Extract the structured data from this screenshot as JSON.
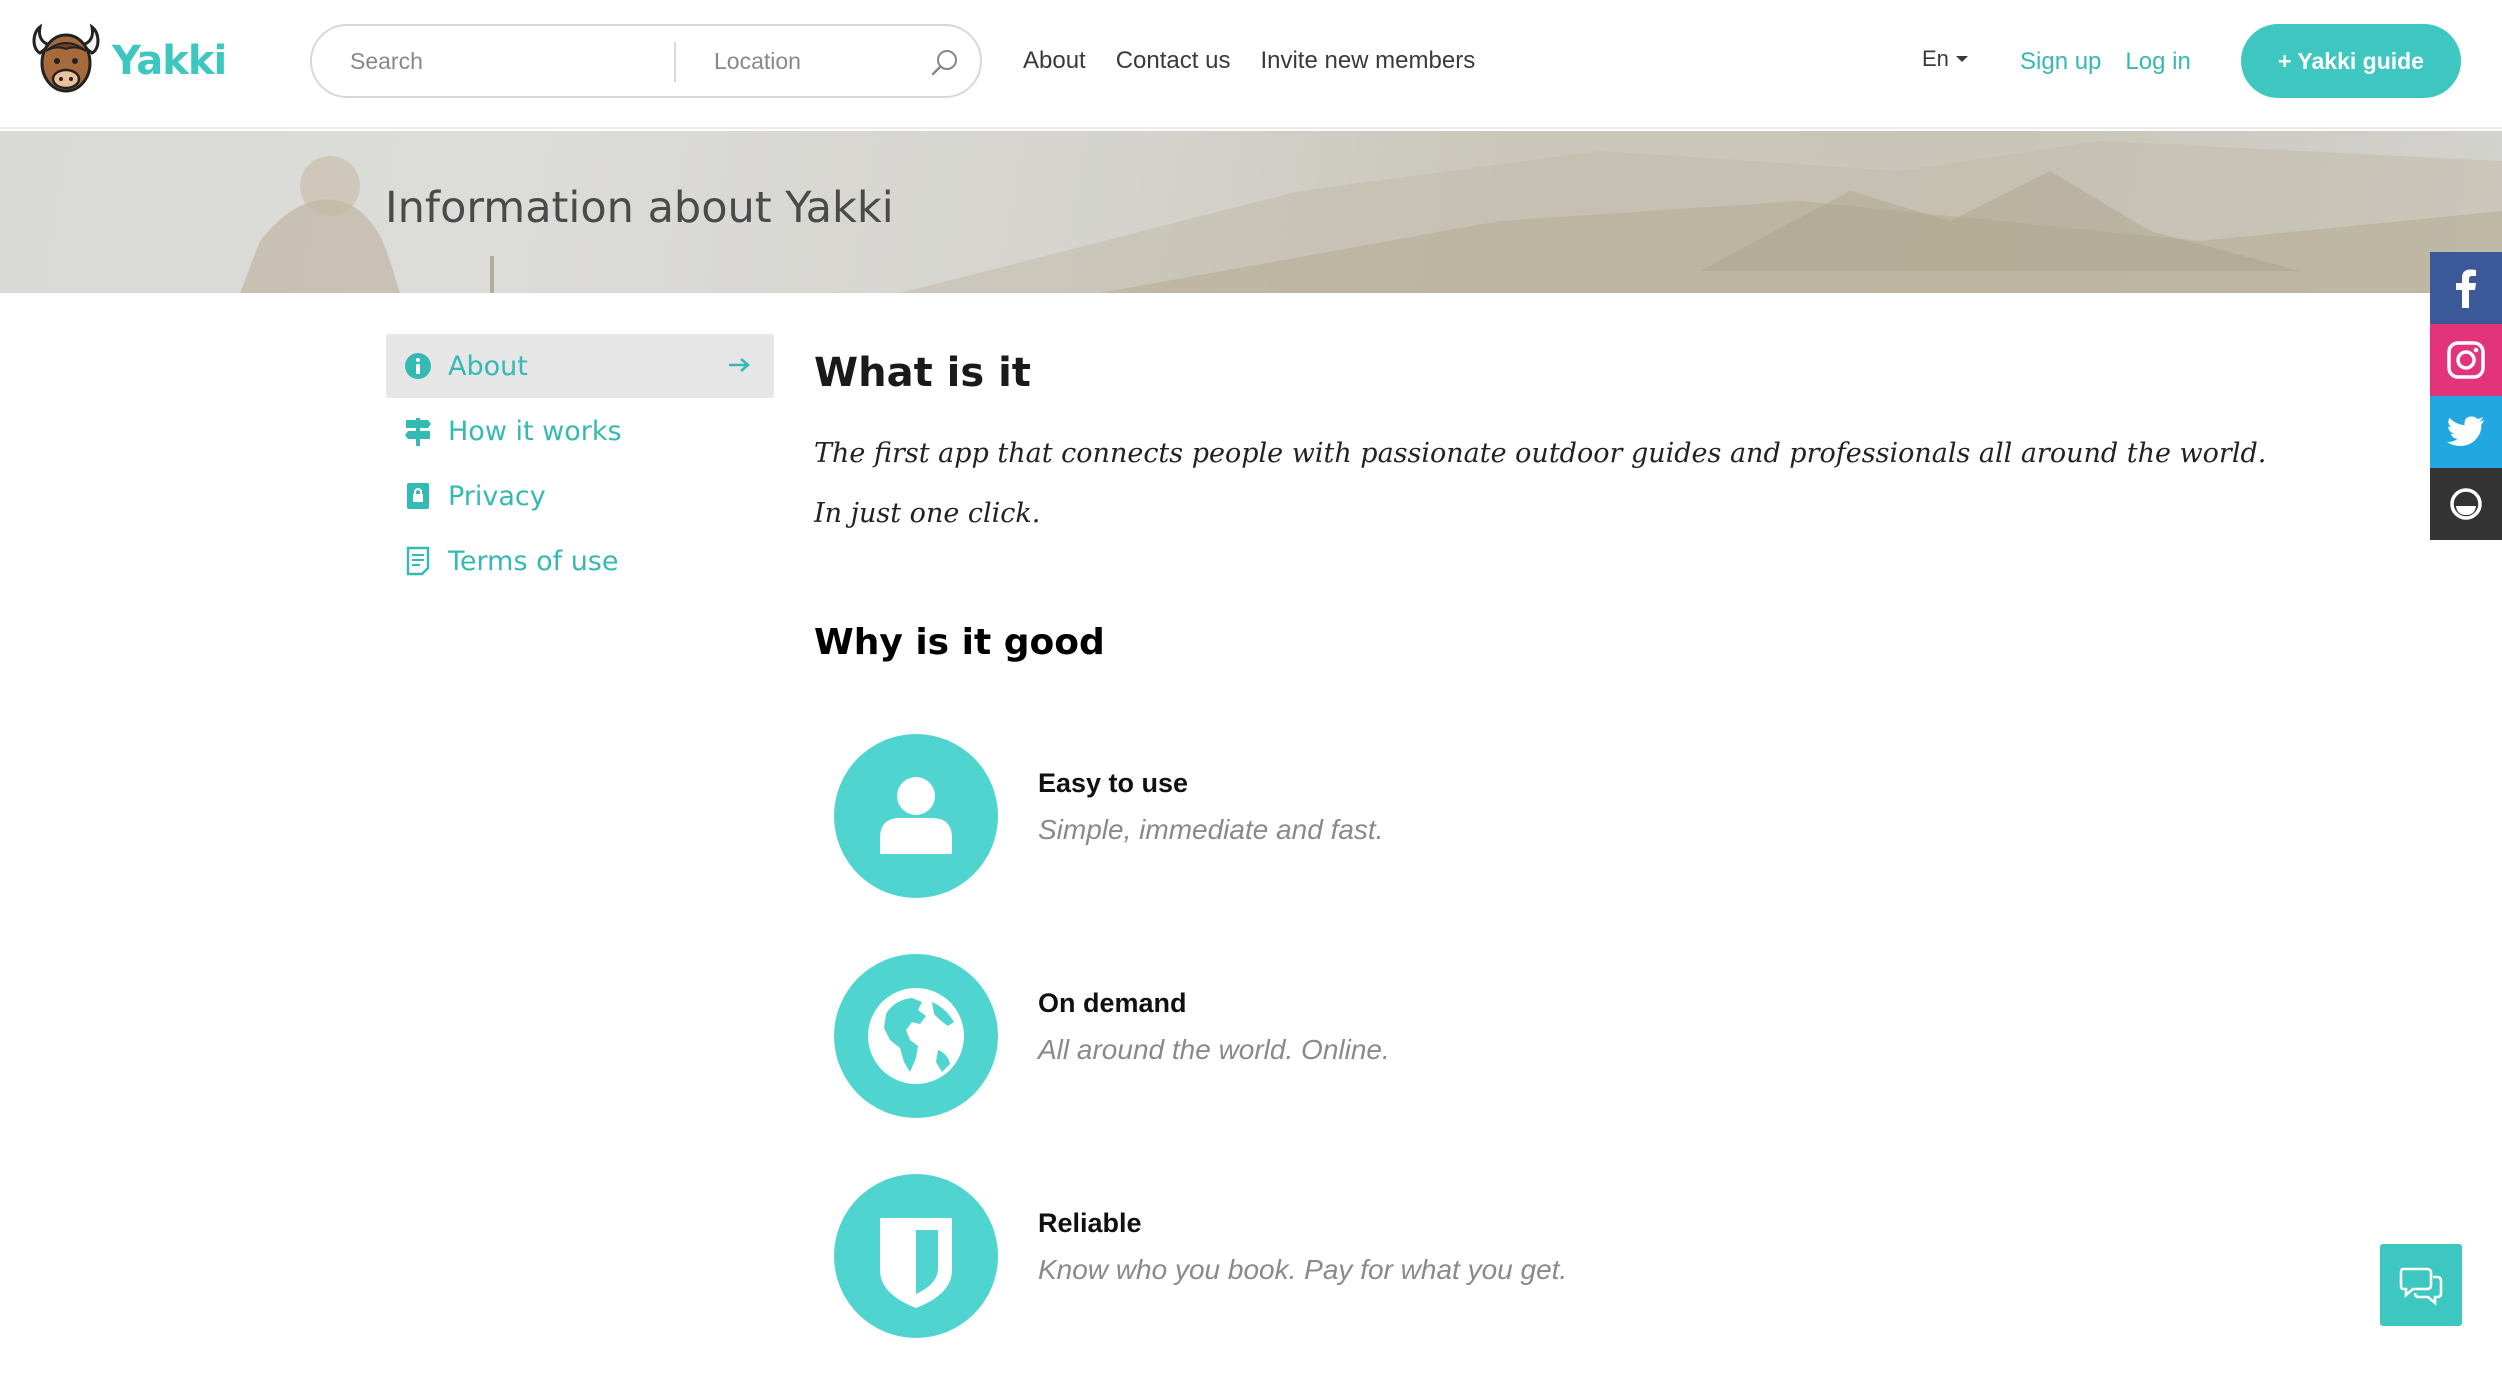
{
  "header": {
    "brand": "Yakki",
    "search_placeholder": "Search",
    "location_placeholder": "Location",
    "nav": [
      "About",
      "Contact us",
      "Invite new members"
    ],
    "language": "En",
    "signup_label": "Sign up",
    "login_label": "Log in",
    "guide_button_label": "+ Yakki guide"
  },
  "hero": {
    "title": "Information about Yakki"
  },
  "sidebar": {
    "items": [
      {
        "label": "About",
        "icon": "info-icon",
        "active": true
      },
      {
        "label": "How it works",
        "icon": "signpost-icon",
        "active": false
      },
      {
        "label": "Privacy",
        "icon": "lock-icon",
        "active": false
      },
      {
        "label": "Terms of use",
        "icon": "document-icon",
        "active": false
      }
    ]
  },
  "main": {
    "what_title": "What is it",
    "what_line1": "The first app that connects people with passionate outdoor guides and professionals all around the world.",
    "what_line2": "In just one click.",
    "why_title": "Why is it good",
    "features": [
      {
        "title": "Easy to use",
        "description": "Simple, immediate and fast.",
        "icon": "user-icon"
      },
      {
        "title": "On demand",
        "description": "All around the world. Online.",
        "icon": "globe-icon"
      },
      {
        "title": "Reliable",
        "description": "Know who you book. Pay for what you get.",
        "icon": "shield-icon"
      }
    ]
  },
  "social": [
    "facebook-icon",
    "instagram-icon",
    "twitter-icon",
    "other-social-icon"
  ],
  "colors": {
    "accent": "#3ec6c1",
    "feature_circle": "#4fd4cf",
    "link": "#35b9b3",
    "facebook": "#3b5998",
    "instagram": "#e3337b",
    "twitter": "#22a8e0",
    "dark": "#333333"
  }
}
